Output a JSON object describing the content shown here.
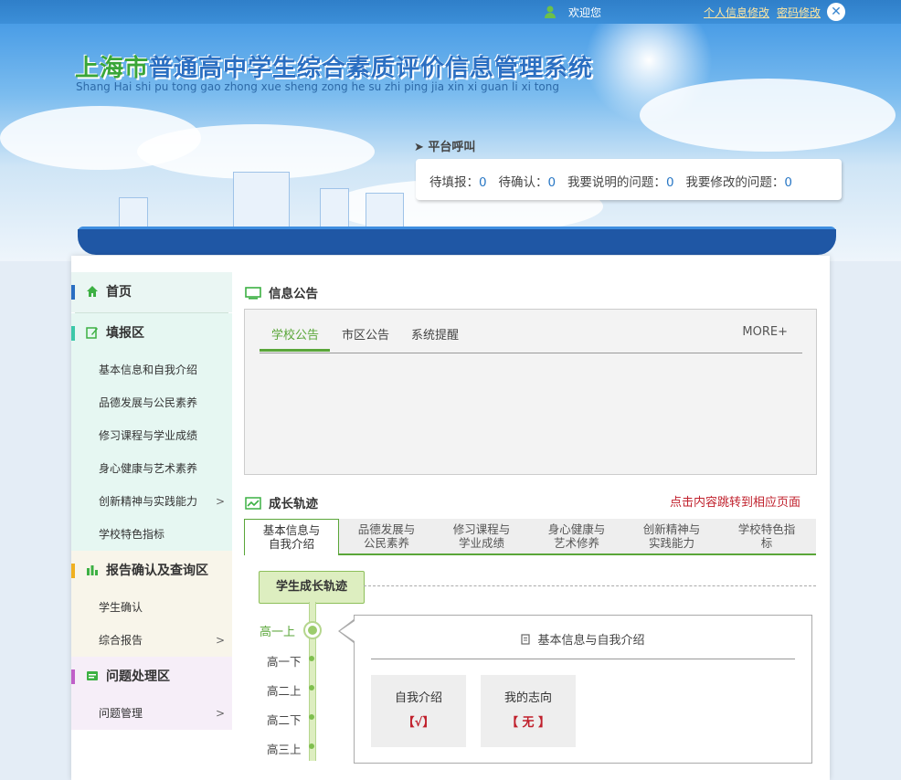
{
  "topbar": {
    "welcome": "欢迎您",
    "profile_link": "个人信息修改",
    "password_link": "密码修改",
    "close_icon": "close-icon"
  },
  "header": {
    "title_city": "上海市",
    "title_rest": "普通高中学生综合素质评价信息管理系统",
    "subtitle": "Shang Hai shi pu tong gao zhong xue sheng zong he su zhi ping jia xin xi guan li xi tong"
  },
  "platform": {
    "label": "平台呼叫",
    "pending_fill_label": "待填报：",
    "pending_fill": "0",
    "pending_confirm_label": "待确认：",
    "pending_confirm": "0",
    "explain_label": "我要说明的问题：",
    "explain": "0",
    "modify_label": "我要修改的问题：",
    "modify": "0"
  },
  "sidebar": {
    "home": "首页",
    "fill_section": "填报区",
    "fill_items": [
      {
        "label": "基本信息和自我介绍"
      },
      {
        "label": "品德发展与公民素养"
      },
      {
        "label": "修习课程与学业成绩"
      },
      {
        "label": "身心健康与艺术素养"
      },
      {
        "label": "创新精神与实践能力",
        "arrow": ">"
      },
      {
        "label": "学校特色指标"
      }
    ],
    "report_section": "报告确认及查询区",
    "report_items": [
      {
        "label": "学生确认"
      },
      {
        "label": "综合报告",
        "arrow": ">"
      }
    ],
    "issue_section": "问题处理区",
    "issue_items": [
      {
        "label": "问题管理",
        "arrow": ">"
      }
    ],
    "colors": {
      "home_bar": "#2a6fc2",
      "fill_bar": "#3cc8a8",
      "report_bar": "#f0b020",
      "issue_bar": "#c060c8"
    }
  },
  "notice": {
    "title": "信息公告",
    "tabs": [
      "学校公告",
      "市区公告",
      "系统提醒"
    ],
    "more": "MORE+"
  },
  "growth": {
    "title": "成长轨迹",
    "hint": "点击内容跳转到相应页面",
    "tabs": [
      {
        "line1": "基本信息与",
        "line2": "自我介绍"
      },
      {
        "line1": "品德发展与",
        "line2": "公民素养"
      },
      {
        "line1": "修习课程与",
        "line2": "学业成绩"
      },
      {
        "line1": "身心健康与",
        "line2": "艺术修养"
      },
      {
        "line1": "创新精神与",
        "line2": "实践能力"
      },
      {
        "line1": "学校特色指",
        "line2": "标"
      }
    ],
    "badge": "学生成长轨迹",
    "timeline": [
      "高一上",
      "高一下",
      "高二上",
      "高二下",
      "高三上"
    ],
    "detail_title": "基本信息与自我介绍",
    "cards": [
      {
        "label": "自我介绍",
        "value": "【√】"
      },
      {
        "label": "我的志向",
        "value": "【 无 】"
      }
    ]
  },
  "accent": "#5aa639"
}
